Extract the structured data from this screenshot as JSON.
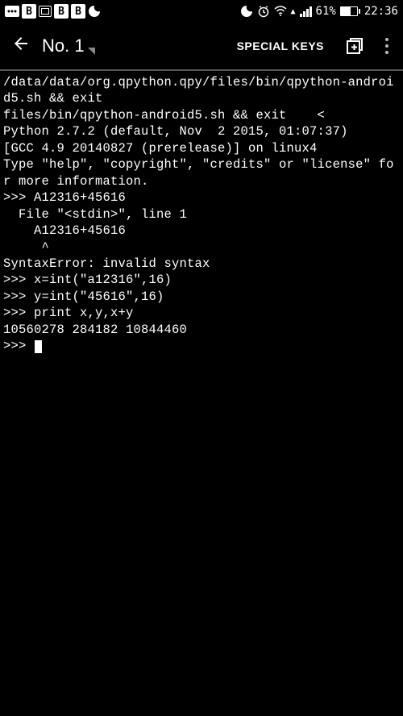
{
  "status": {
    "battery_pct": "61%",
    "time": "22:36"
  },
  "appbar": {
    "title": "No. 1",
    "special_keys": "SPECIAL KEYS"
  },
  "terminal": {
    "lines": [
      "/data/data/org.qpython.qpy/files/bin/qpython-android5.sh && exit",
      "files/bin/qpython-android5.sh && exit    <",
      "Python 2.7.2 (default, Nov  2 2015, 01:07:37)",
      "[GCC 4.9 20140827 (prerelease)] on linux4",
      "Type \"help\", \"copyright\", \"credits\" or \"license\" for more information.",
      ">>> A12316+45616",
      "  File \"<stdin>\", line 1",
      "    A12316+45616",
      "     ^",
      "SyntaxError: invalid syntax",
      ">>> x=int(\"a12316\",16)",
      ">>> y=int(\"45616\",16)",
      ">>> print x,y,x+y",
      "10560278 284182 10844460",
      ">>> "
    ]
  }
}
